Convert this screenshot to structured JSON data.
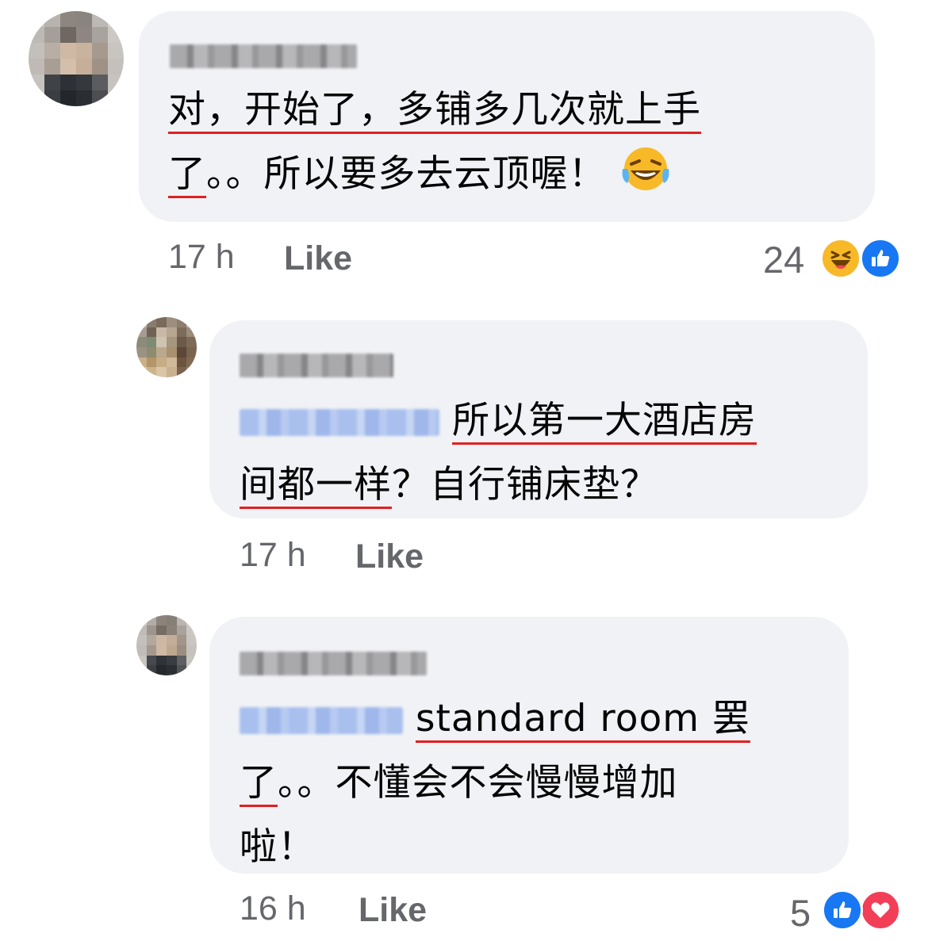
{
  "comments": [
    {
      "text_line1": "对，开始了，多铺多几次就上手",
      "text_line2_underlined": "了",
      "text_line2_rest": "。。所以要多去云顶喔！",
      "emoji": "laughing-tears-emoji",
      "time": "17 h",
      "like_label": "Like",
      "reaction_count": "24",
      "reactions": [
        "haha-icon",
        "like-icon"
      ]
    },
    {
      "text_line1": "所以第一大酒店房",
      "text_line2_underlined": "间都一样",
      "text_line2_rest": "？自行铺床垫？",
      "time": "17 h",
      "like_label": "Like"
    },
    {
      "text_line1": "standard room 罢",
      "text_line2_underlined": "了",
      "text_line2_rest": "。。不懂会不会慢慢增加",
      "text_line3": "啦！",
      "time": "16 h",
      "like_label": "Like",
      "reaction_count": "5",
      "reactions": [
        "like-icon",
        "love-icon"
      ]
    }
  ],
  "colors": {
    "bubble": "#f0f2f5",
    "meta_text": "#65676b",
    "underline": "#e02020",
    "like_blue": "#1877f2",
    "love_red": "#f33e58",
    "haha_yellow": "#f7b928"
  }
}
